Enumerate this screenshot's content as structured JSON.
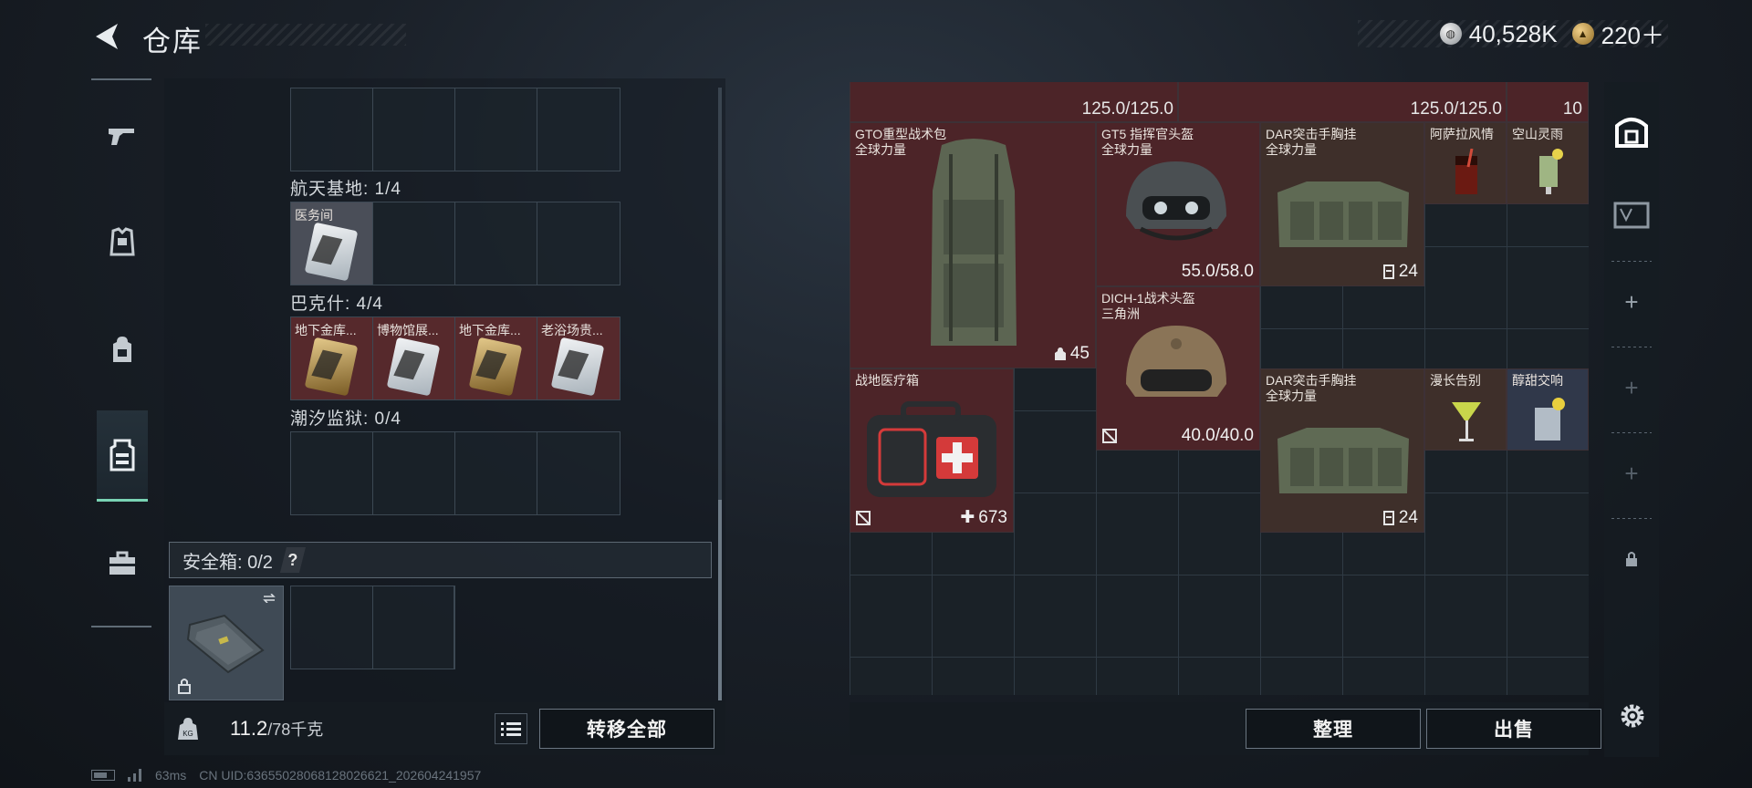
{
  "header": {
    "title": "仓库",
    "currency_silver": "40,528K",
    "currency_gold": "220＋"
  },
  "left_nav": {
    "items": [
      "gun-icon",
      "armor-icon",
      "backpack-icon",
      "chest-rig-icon",
      "case-icon"
    ],
    "active": "chest-rig-icon"
  },
  "collections": [
    {
      "label": "航天基地: 1/4",
      "items": [
        "医务间"
      ]
    },
    {
      "label": "巴克什: 4/4",
      "items": [
        "地下金库...",
        "博物馆展...",
        "地下金库...",
        "老浴场贵..."
      ]
    },
    {
      "label": "潮汐监狱: 0/4",
      "items": []
    }
  ],
  "safe_box": {
    "label": "安全箱: 0/2",
    "help": "?"
  },
  "footer_left": {
    "weight": "11.2",
    "capacity": "/78千克",
    "transfer_all": "转移全部"
  },
  "status": {
    "ping": "63ms",
    "uid": "CN UID:63655028068128026621_202604241957"
  },
  "stash": {
    "top_values": [
      "125.0/125.0",
      "125.0/125.0",
      "10"
    ],
    "items": [
      {
        "name": "GTO重型战术包",
        "sub": "全球力量",
        "value": "45"
      },
      {
        "name": "GT5 指挥官头盔",
        "sub": "全球力量",
        "value": "55.0/58.0"
      },
      {
        "name": "DAR突击手胸挂",
        "sub": "全球力量",
        "value": "24"
      },
      {
        "name": "阿萨拉风情",
        "sub": "",
        "value": ""
      },
      {
        "name": "空山灵雨",
        "sub": "",
        "value": ""
      },
      {
        "name": "DICH-1战术头盔",
        "sub": "三角洲",
        "value": "40.0/40.0"
      },
      {
        "name": "战地医疗箱",
        "sub": "",
        "value": "673"
      },
      {
        "name": "DAR突击手胸挂",
        "sub": "全球力量",
        "value": "24"
      },
      {
        "name": "漫长告别",
        "sub": "",
        "value": ""
      },
      {
        "name": "醇甜交响",
        "sub": "",
        "value": ""
      }
    ]
  },
  "footer_right": {
    "organize": "整理",
    "sell": "出售"
  }
}
